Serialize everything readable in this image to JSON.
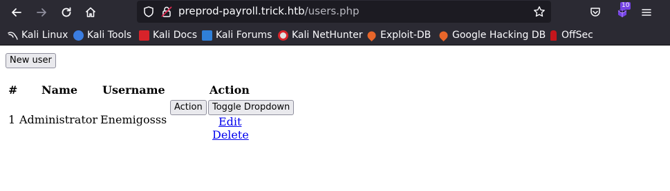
{
  "browser": {
    "url_host": "preprod-payroll.trick.htb",
    "url_path": "/users.php",
    "extensions_badge": "10"
  },
  "bookmarks": [
    {
      "label": "Kali Linux",
      "icon": "kali-dragon-icon"
    },
    {
      "label": "Kali Tools",
      "icon": "kali-tools-icon"
    },
    {
      "label": "Kali Docs",
      "icon": "kali-docs-icon"
    },
    {
      "label": "Kali Forums",
      "icon": "kali-forums-icon"
    },
    {
      "label": "Kali NetHunter",
      "icon": "nethunter-icon"
    },
    {
      "label": "Exploit-DB",
      "icon": "exploit-db-icon"
    },
    {
      "label": "Google Hacking DB",
      "icon": "ghdb-icon"
    },
    {
      "label": "OffSec",
      "icon": "offsec-icon"
    }
  ],
  "page": {
    "new_user_label": "New user",
    "table": {
      "headers": [
        "#",
        "Name",
        "Username",
        "Action"
      ],
      "rows": [
        {
          "num": "1",
          "name": "Administrator",
          "username": "Enemigosss",
          "action_label": "Action",
          "toggle_label": "Toggle Dropdown",
          "edit_label": "Edit",
          "delete_label": "Delete"
        }
      ]
    }
  }
}
